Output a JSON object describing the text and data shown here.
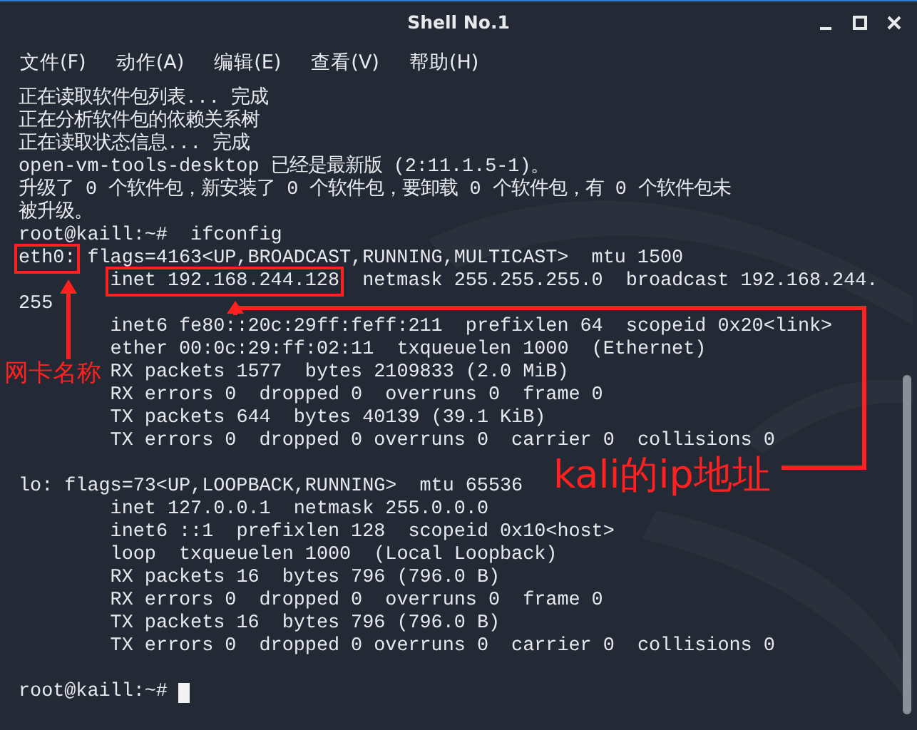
{
  "window": {
    "title": "Shell No.1"
  },
  "menu": [
    "文件(F)",
    "动作(A)",
    "编辑(E)",
    "查看(V)",
    "帮助(H)"
  ],
  "terminal": {
    "lines": [
      {
        "kind": "text",
        "text": "正在读取软件包列表... 完成"
      },
      {
        "kind": "text",
        "text": "正在分析软件包的依赖关系树"
      },
      {
        "kind": "text",
        "text": "正在读取状态信息... 完成"
      },
      {
        "kind": "text",
        "text": "open-vm-tools-desktop 已经是最新版 (2:11.1.5-1)。"
      },
      {
        "kind": "text",
        "text": "升级了 0 个软件包，新安装了 0 个软件包，要卸载 0 个软件包，有 0 个软件包未"
      },
      {
        "kind": "text",
        "text": "被升级。"
      },
      {
        "kind": "text",
        "text": "root@kaill:~#  ifconfig"
      },
      {
        "kind": "marked",
        "indented": false,
        "marked": "eth0:",
        "rest": " flags=4163<UP,BROADCAST,RUNNING,MULTICAST>  mtu 1500"
      },
      {
        "kind": "marked",
        "indented": true,
        "marked": "inet 192.168.244.128",
        "rest": "  netmask 255.255.255.0  broadcast 192.168.244."
      },
      {
        "kind": "text",
        "text": "255"
      },
      {
        "kind": "text",
        "text": "        inet6 fe80::20c:29ff:feff:211  prefixlen 64  scopeid 0x20<link>"
      },
      {
        "kind": "text",
        "text": "        ether 00:0c:29:ff:02:11  txqueuelen 1000  (Ethernet)"
      },
      {
        "kind": "text",
        "text": "        RX packets 1577  bytes 2109833 (2.0 MiB)"
      },
      {
        "kind": "text",
        "text": "        RX errors 0  dropped 0  overruns 0  frame 0"
      },
      {
        "kind": "text",
        "text": "        TX packets 644  bytes 40139 (39.1 KiB)"
      },
      {
        "kind": "text",
        "text": "        TX errors 0  dropped 0 overruns 0  carrier 0  collisions 0"
      },
      {
        "kind": "blank"
      },
      {
        "kind": "text",
        "text": "lo: flags=73<UP,LOOPBACK,RUNNING>  mtu 65536"
      },
      {
        "kind": "text",
        "text": "        inet 127.0.0.1  netmask 255.0.0.0"
      },
      {
        "kind": "text",
        "text": "        inet6 ::1  prefixlen 128  scopeid 0x10<host>"
      },
      {
        "kind": "text",
        "text": "        loop  txqueuelen 1000  (Local Loopback)"
      },
      {
        "kind": "text",
        "text": "        RX packets 16  bytes 796 (796.0 B)"
      },
      {
        "kind": "text",
        "text": "        RX errors 0  dropped 0  overruns 0  frame 0"
      },
      {
        "kind": "text",
        "text": "        TX packets 16  bytes 796 (796.0 B)"
      },
      {
        "kind": "text",
        "text": "        TX errors 0  dropped 0 overruns 0  carrier 0  collisions 0"
      },
      {
        "kind": "blank"
      },
      {
        "kind": "prompt",
        "text": "root@kaill:~#"
      }
    ]
  },
  "annotations": [
    "网卡名称",
    "kali的ip地址"
  ]
}
